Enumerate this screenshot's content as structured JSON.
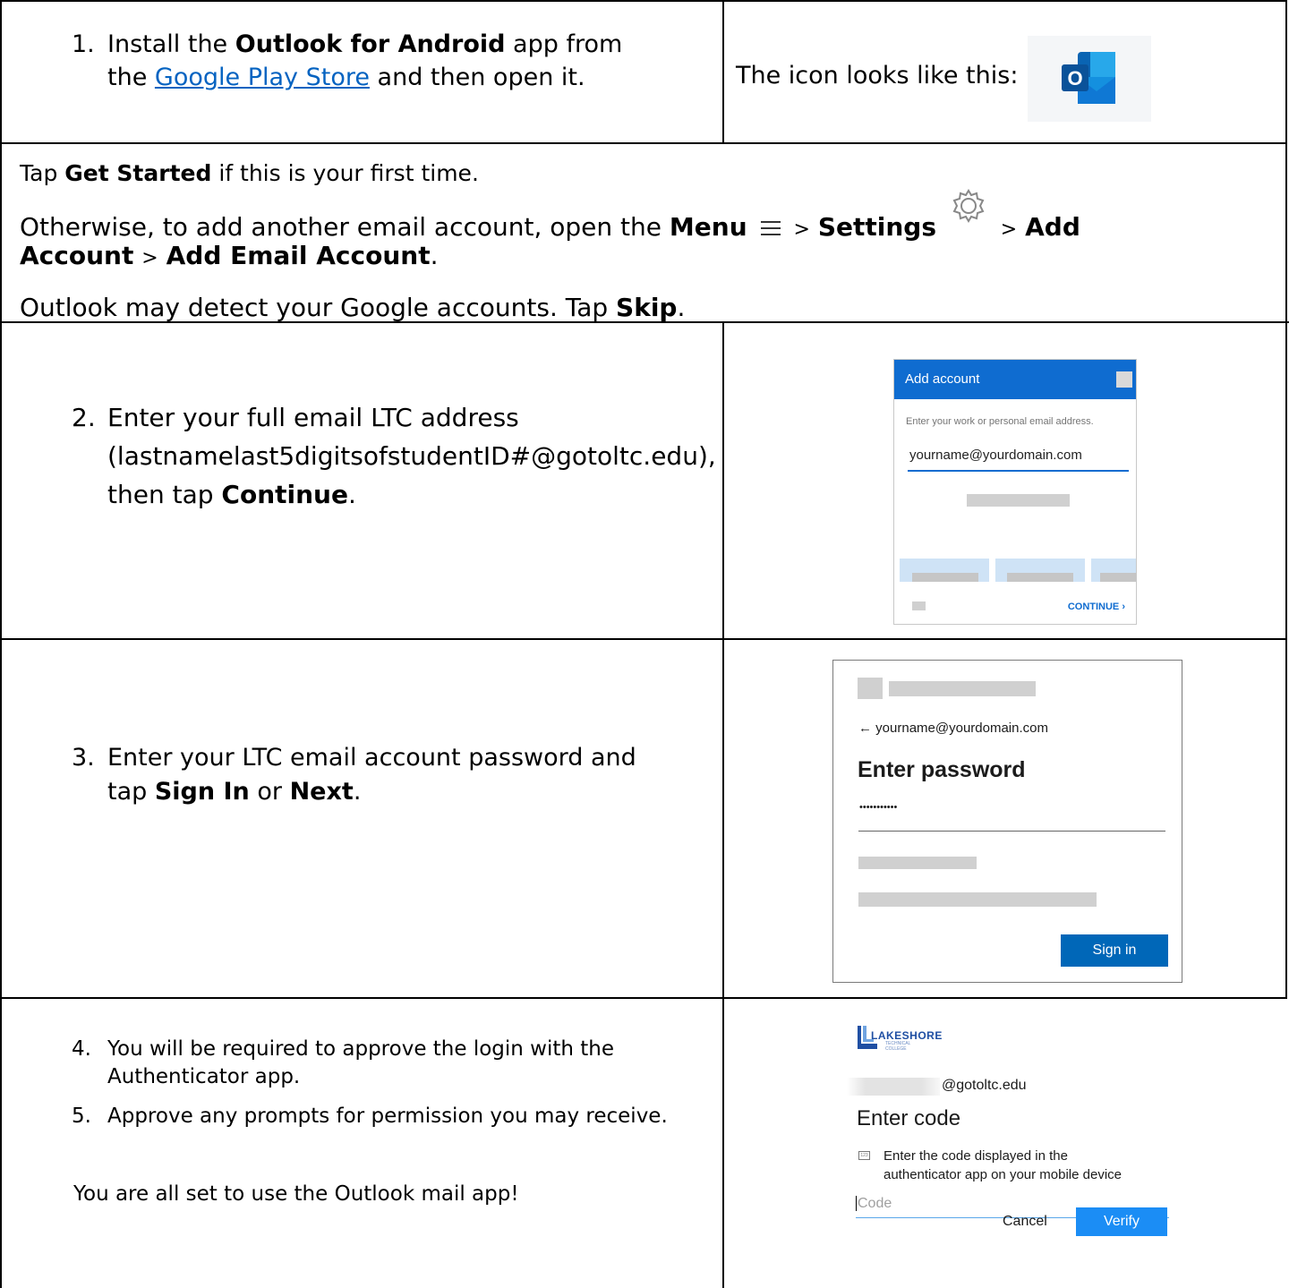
{
  "row1": {
    "step_num": "1.",
    "line1_pre": "Install the ",
    "line1_bold": "Outlook for Android",
    "line1_post": " app from",
    "line2_pre": "the ",
    "line2_link": "Google Play Store",
    "line2_post": " and then open it.",
    "icon_caption": "The icon looks like this:",
    "icon_letter": "O"
  },
  "section2": {
    "p1_pre": "Tap ",
    "p1_bold": "Get Started",
    "p1_post": " if this is your first time.",
    "p2_a": "Otherwise, to add another email account, open the ",
    "p2_menu": "Menu",
    "sep": ">",
    "p2_settings": "Settings",
    "p2_add": "Add",
    "p3_account": "Account",
    "p3_add_email": "Add Email Account",
    "period": ".",
    "p4_pre": "Outlook may detect your Google accounts. Tap ",
    "p4_bold": "Skip"
  },
  "row2": {
    "step_num": "2.",
    "line1": "Enter your full email LTC address",
    "line2": "(lastnamelast5digitsofstudentID#@gotoltc.edu),",
    "line3_pre": "then tap ",
    "line3_bold": "Continue",
    "screenshot": {
      "header": "Add account",
      "prompt": "Enter your work or personal email address.",
      "email": "yourname@yourdomain.com",
      "continue": "CONTINUE"
    }
  },
  "row3": {
    "step_num": "3.",
    "line1": "Enter your LTC email account password and",
    "line2_pre": "tap ",
    "line2_b1": "Sign In",
    "line2_mid": " or ",
    "line2_b2": "Next",
    "screenshot": {
      "email": "yourname@yourdomain.com",
      "title": "Enter password",
      "password": "•••••••••••",
      "signin": "Sign in"
    }
  },
  "row4": {
    "step4_num": "4.",
    "step4_l1": "You will be required to approve the login with the",
    "step4_l2": "Authenticator app.",
    "step5_num": "5.",
    "step5": "Approve any prompts for permission you may receive.",
    "final": "You are all set to use the Outlook mail app!",
    "screenshot": {
      "logo_main": "LAKESHORE",
      "logo_sub1": "TECHNICAL",
      "logo_sub2": "COLLEGE",
      "domain": "@gotoltc.edu",
      "title": "Enter code",
      "inst1": "Enter the code displayed in the",
      "inst2": "authenticator app on your mobile device",
      "placeholder": "Code",
      "cancel": "Cancel",
      "verify": "Verify"
    }
  }
}
